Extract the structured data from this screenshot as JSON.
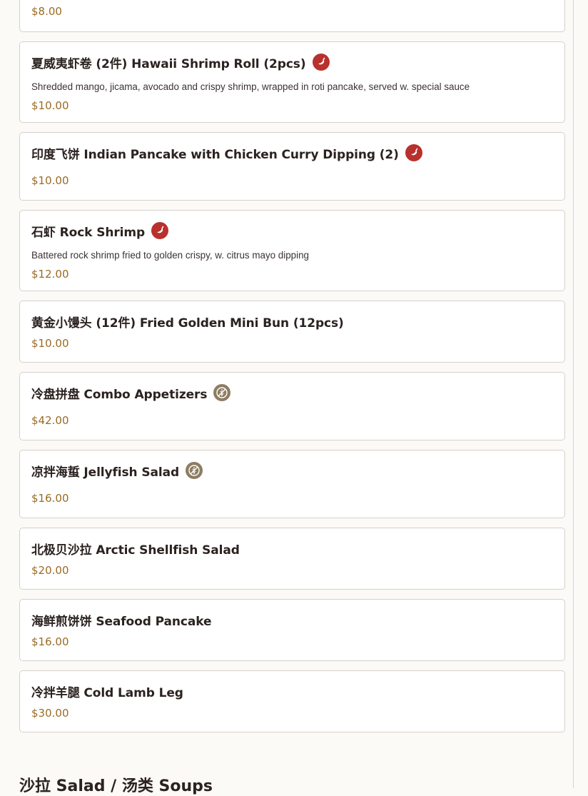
{
  "items": [
    {
      "name": "",
      "desc": "",
      "price": "$8.00",
      "badge": ""
    },
    {
      "name": "夏威夷虾卷 (2件) Hawaii Shrimp Roll (2pcs)",
      "desc": "Shredded mango, jicama, avocado and crispy shrimp, wrapped in roti pancake, served w. special sauce",
      "price": "$10.00",
      "badge": "spicy"
    },
    {
      "name": "印度飞饼 Indian Pancake with Chicken Curry Dipping (2)",
      "desc": "",
      "price": "$10.00",
      "badge": "spicy"
    },
    {
      "name": "石虾 Rock Shrimp",
      "desc": "Battered rock shrimp fried to golden crispy, w. citrus mayo dipping",
      "price": "$12.00",
      "badge": "spicy"
    },
    {
      "name": "黄金小馒头 (12件) Fried Golden Mini Bun (12pcs)",
      "desc": "",
      "price": "$10.00",
      "badge": ""
    },
    {
      "name": "冷盘拼盘 Combo Appetizers",
      "desc": "",
      "price": "$42.00",
      "badge": "gluten-free"
    },
    {
      "name": "凉拌海蜇 Jellyfish Salad",
      "desc": "",
      "price": "$16.00",
      "badge": "gluten-free"
    },
    {
      "name": "北极贝沙拉 Arctic Shellfish Salad",
      "desc": "",
      "price": "$20.00",
      "badge": ""
    },
    {
      "name": "海鲜煎饼饼 Seafood Pancake",
      "desc": "",
      "price": "$16.00",
      "badge": ""
    },
    {
      "name": "冷拌羊腿 Cold Lamb Leg",
      "desc": "",
      "price": "$30.00",
      "badge": ""
    }
  ],
  "section": {
    "heading": "沙拉 Salad / 汤类 Soups"
  },
  "icons": {
    "spicy": "chili-pepper-icon",
    "gluten-free": "gluten-free-icon"
  },
  "colors": {
    "price": "#9a6b24",
    "spicy_badge": "#b8312d",
    "gf_badge": "#8d7d62",
    "card_border": "#d6d0cb"
  }
}
